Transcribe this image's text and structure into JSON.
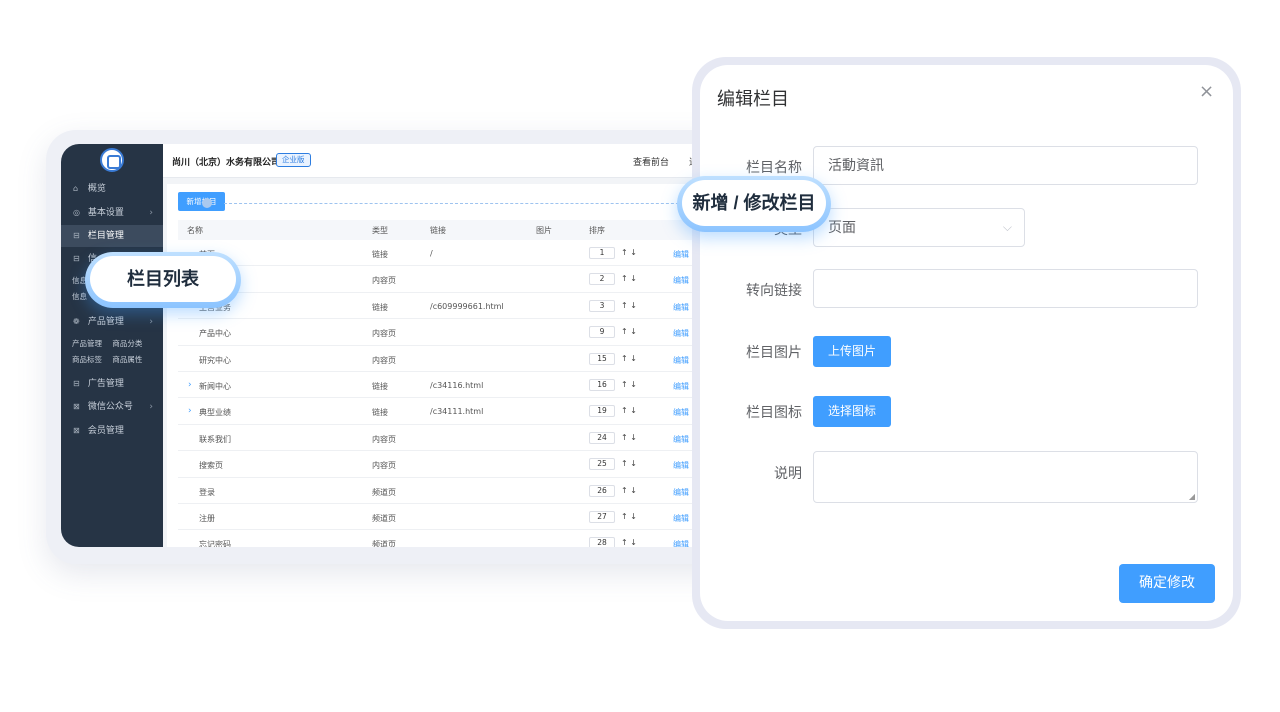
{
  "sidebar": {
    "items": [
      {
        "icon": "home-icon",
        "glyph": "⌂",
        "label": "概览"
      },
      {
        "icon": "settings-icon",
        "glyph": "◎",
        "label": "基本设置",
        "arrow": "›"
      },
      {
        "icon": "column-icon",
        "glyph": "⊟",
        "label": "栏目管理",
        "active": true
      },
      {
        "icon": "info-icon",
        "glyph": "⊟",
        "label": "信"
      },
      {
        "icon": "product-icon",
        "glyph": "❁",
        "label": "产品管理",
        "arrow": "›"
      },
      {
        "icon": "ad-icon",
        "glyph": "⊟",
        "label": "广告管理"
      },
      {
        "icon": "wechat-icon",
        "glyph": "⊠",
        "label": "微信公众号",
        "arrow": "›"
      },
      {
        "icon": "member-icon",
        "glyph": "⊠",
        "label": "会员管理"
      }
    ],
    "info_sub_1": "信息",
    "info_sub_2": "信息",
    "product_sub": [
      "产品管理",
      "商品分类"
    ],
    "product_sub2": [
      "商品标签",
      "商品属性"
    ]
  },
  "topbar": {
    "company": "尚川（北京）水务有限公司",
    "edition": "企业版",
    "front_link": "查看前台",
    "extra_link": "退"
  },
  "content": {
    "add_button": "新增栏目",
    "columns": [
      "名称",
      "类型",
      "链接",
      "图片",
      "排序"
    ],
    "rows": [
      {
        "name": "首页",
        "type": "链接",
        "link": "/",
        "sort": "1",
        "expand": false
      },
      {
        "name": "",
        "type": "内容页",
        "link": "",
        "sort": "2",
        "expand": false
      },
      {
        "name": "主营业务",
        "type": "链接",
        "link": "/c609999661.html",
        "sort": "3",
        "expand": true
      },
      {
        "name": "产品中心",
        "type": "内容页",
        "link": "",
        "sort": "9",
        "expand": false
      },
      {
        "name": "研究中心",
        "type": "内容页",
        "link": "",
        "sort": "15",
        "expand": false
      },
      {
        "name": "新闻中心",
        "type": "链接",
        "link": "/c34116.html",
        "sort": "16",
        "expand": true
      },
      {
        "name": "典型业绩",
        "type": "链接",
        "link": "/c34111.html",
        "sort": "19",
        "expand": true
      },
      {
        "name": "联系我们",
        "type": "内容页",
        "link": "",
        "sort": "24",
        "expand": false
      },
      {
        "name": "搜索页",
        "type": "内容页",
        "link": "",
        "sort": "25",
        "expand": false
      },
      {
        "name": "登录",
        "type": "频道页",
        "link": "",
        "sort": "26",
        "expand": false
      },
      {
        "name": "注册",
        "type": "频道页",
        "link": "",
        "sort": "27",
        "expand": false
      },
      {
        "name": "忘记密码",
        "type": "频道页",
        "link": "",
        "sort": "28",
        "expand": false
      }
    ],
    "row_arrows": "↑ ↓",
    "edit_label": "编辑",
    "expand_glyph": "›"
  },
  "callouts": {
    "list": "栏目列表",
    "edit": "新增 / 修改栏目"
  },
  "dialog": {
    "title": "编辑栏目",
    "close_glyph": "×",
    "fields": {
      "name_label": "栏目名称",
      "name_value": "活動資訊",
      "type_label": "类型",
      "type_value": "页面",
      "redirect_label": "转向链接",
      "redirect_value": "",
      "image_label": "栏目图片",
      "image_button": "上传图片",
      "icon_label": "栏目图标",
      "icon_button": "选择图标",
      "desc_label": "说明"
    },
    "select_arrow": "⌵",
    "confirm_button": "确定修改"
  },
  "colors": {
    "accent": "#409eff",
    "sidebar_bg": "#263445"
  }
}
